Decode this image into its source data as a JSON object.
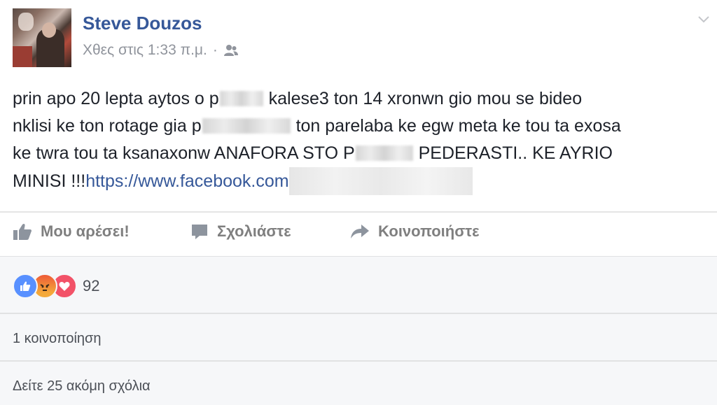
{
  "post": {
    "author": "Steve Douzos",
    "timestamp": "Χθες στις 1:33 π.μ.",
    "separator": "·",
    "audience_icon": "friends-icon",
    "text": {
      "line1_a": "prin apo 20 lepta aytos o p",
      "line1_b": "kalese3 ton 14 xronwn gio mou se bideo",
      "line2_a": "nklisi ke ton rotage gia p",
      "line2_b": "ton parelaba ke egw meta ke tou ta exosa",
      "line3_a": "ke twra tou ta ksanaxonw ANAFORA STO P",
      "line3_b": "PEDERASTI.. KE AYRIO",
      "line4_a": "MINISI !!!",
      "link": "https://www.facebook.com"
    }
  },
  "actions": {
    "like": "Μου αρέσει!",
    "comment": "Σχολιάστε",
    "share": "Κοινοποιήστε"
  },
  "reactions": {
    "icons": [
      "like-reaction-icon",
      "angry-reaction-icon",
      "love-reaction-icon"
    ],
    "count": "92"
  },
  "shares": "1 κοινοποίηση",
  "more_comments": "Δείτε 25 ακόμη σχόλια",
  "colors": {
    "name_link": "#365899",
    "meta": "#90949c",
    "action": "#7f7f7f",
    "footer_bg": "#f6f7f9"
  }
}
